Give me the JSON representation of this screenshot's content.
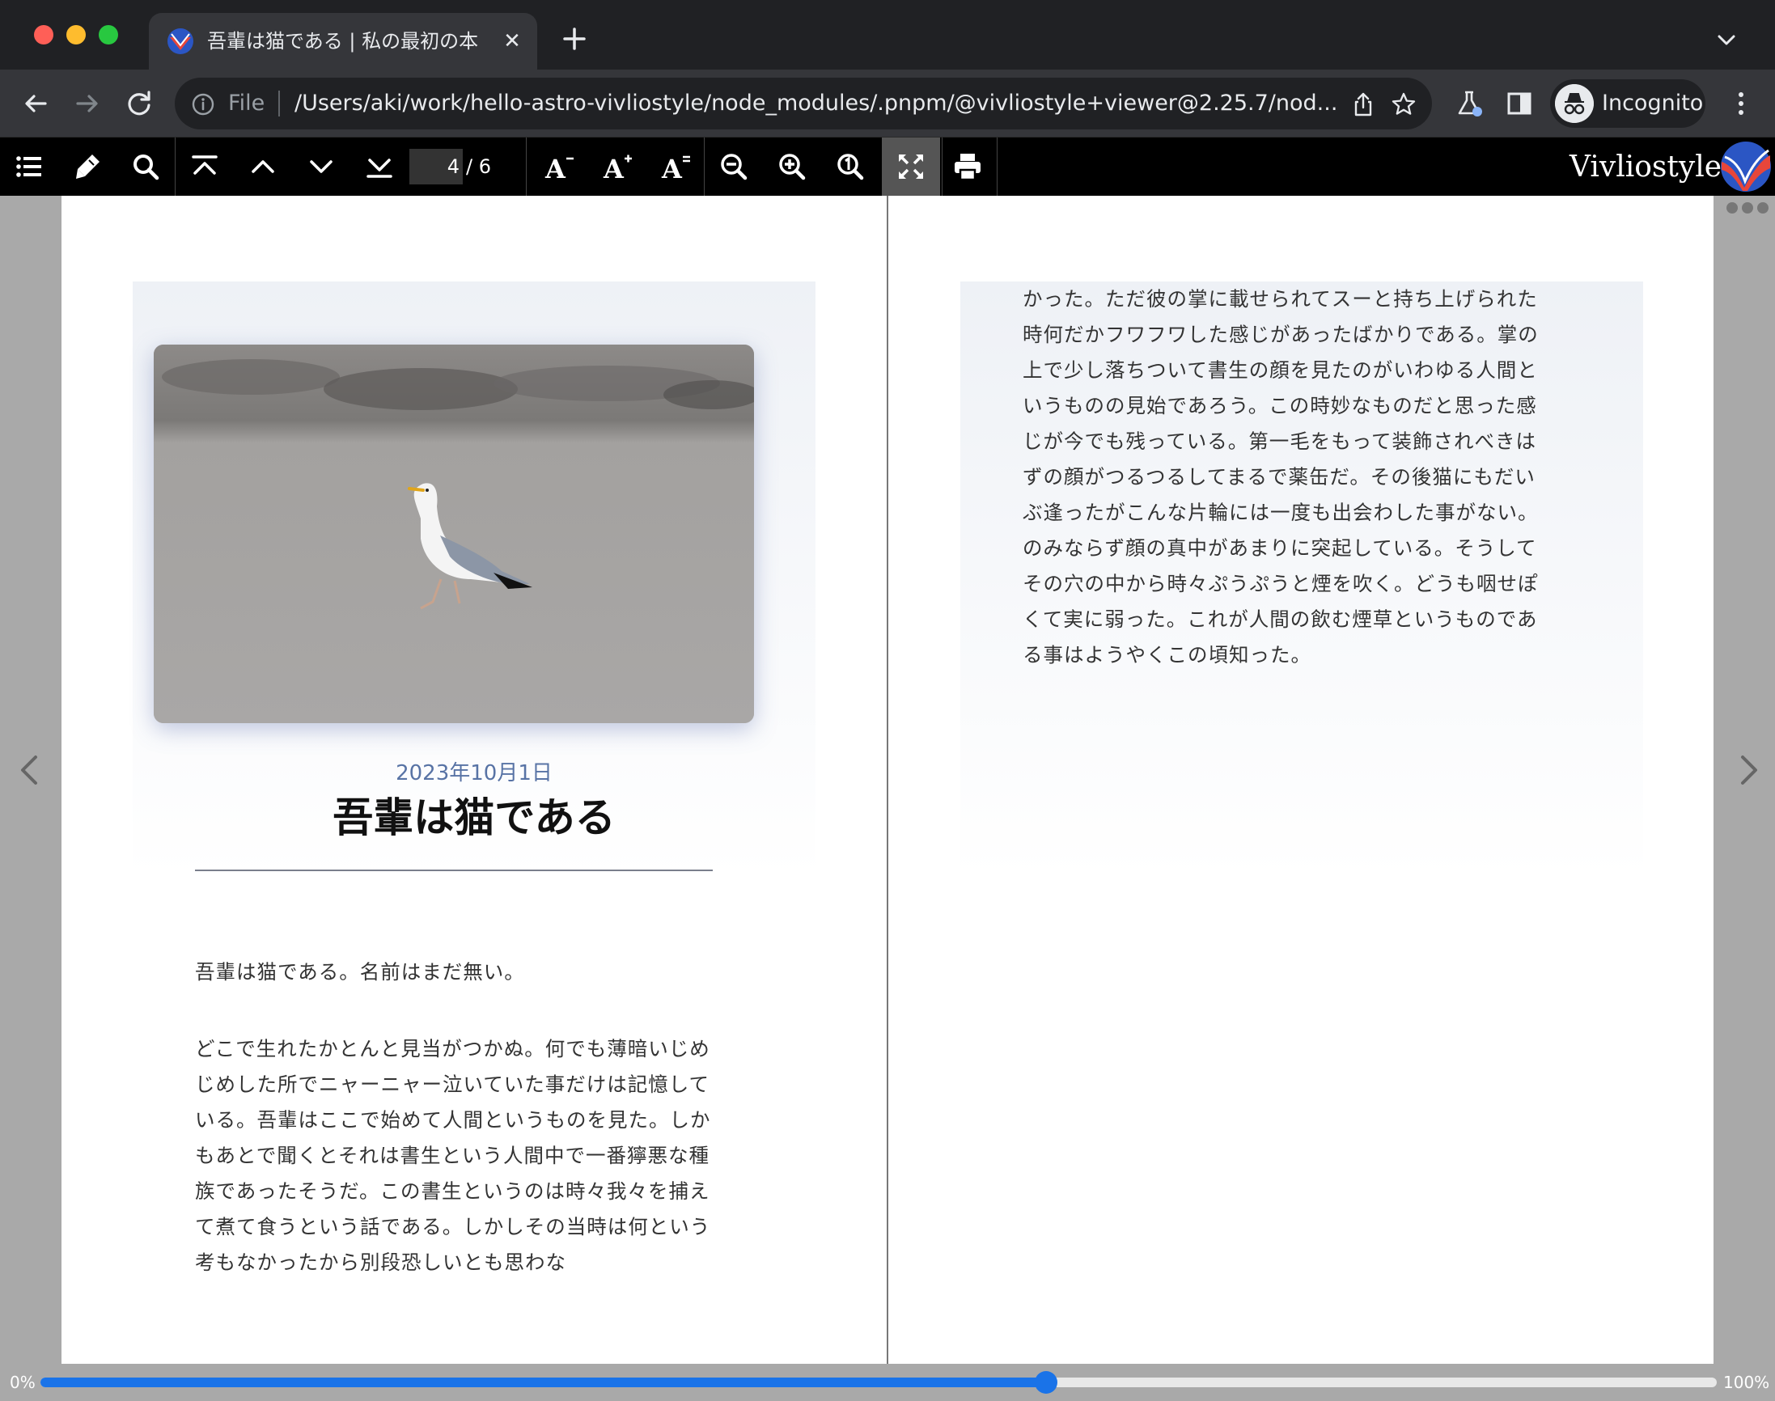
{
  "browser": {
    "tab_title": "吾輩は猫である | 私の最初の本",
    "tab_close": "✕",
    "scheme": "File",
    "url": "/Users/aki/work/hello-astro-vivliostyle/node_modules/.pnpm/@vivliostyle+viewer@2.25.7/nod...",
    "incognito_label": "Incognito"
  },
  "viewer": {
    "current_page": "4",
    "total_pages": "/ 6",
    "brand": "Vivliostyle"
  },
  "left_page": {
    "date": "2023年10月1日",
    "title": "吾輩は猫である",
    "para1": "吾輩は猫である。名前はまだ無い。",
    "para2": "どこで生れたかとんと見当がつかぬ。何でも薄暗いじめじめした所でニャーニャー泣いていた事だけは記憶している。吾輩はここで始めて人間というものを見た。しかもあとで聞くとそれは書生という人間中で一番獰悪な種族であったそうだ。この書生というのは時々我々を捕えて煮て食うという話である。しかしその当時は何という考もなかったから別段恐しいとも思わな"
  },
  "right_page": {
    "para": "かった。ただ彼の掌に載せられてスーと持ち上げられた時何だかフワフワした感じがあったばかりである。掌の上で少し落ちついて書生の顔を見たのがいわゆる人間というものの見始であろう。この時妙なものだと思った感じが今でも残っている。第一毛をもって装飾されべきはずの顔がつるつるしてまるで薬缶だ。その後猫にもだいぶ逢ったがこんな片輪には一度も出会わした事がない。のみならず顔の真中があまりに突起している。そうしてその穴の中から時々ぷうぷうと煙を吹く。どうも咽せぽくて実に弱った。これが人間の飲む煙草というものである事はようやくこの頃知った。"
  },
  "progress": {
    "min_label": "0%",
    "max_label": "100%",
    "value": 0.6
  },
  "colors": {
    "accent": "#1a73e8",
    "date": "#5873a5"
  }
}
